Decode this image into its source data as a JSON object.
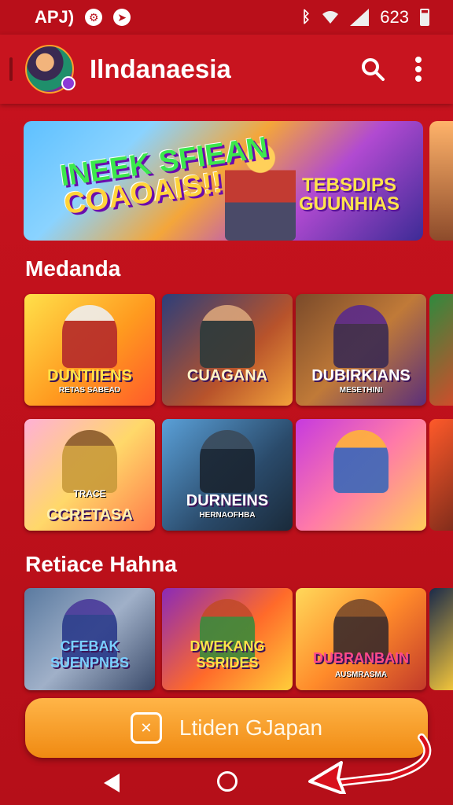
{
  "status_bar": {
    "left_text": "APJ)",
    "icons": [
      "app-icon",
      "location-icon"
    ],
    "battery_text": "623",
    "right_icons": [
      "bluetooth-icon",
      "wifi-icon",
      "signal-icon",
      "battery-icon"
    ]
  },
  "app_bar": {
    "title": "Ilndanaesia",
    "actions": [
      "search-icon",
      "more-vert-icon"
    ]
  },
  "banner": {
    "left_line1": "INEEK SFIEAN",
    "left_line2": "COAOAIS!!",
    "right_line1": "TEBSDIPS",
    "right_line2": "GUUNHIAS"
  },
  "sections": [
    {
      "title": "Medanda",
      "rows": [
        [
          {
            "label": "DUNTIIENS",
            "sub": "RETAS SABEAD"
          },
          {
            "label": "CUAGANA",
            "sub": ""
          },
          {
            "label": "DUBIRKIANS",
            "sub": "MESETHINI"
          }
        ],
        [
          {
            "label": "CCRETASA",
            "sub": "TRACE"
          },
          {
            "label": "DURNEINS",
            "sub": "HERNAOFHBA"
          },
          {
            "label": "",
            "sub": ""
          }
        ]
      ]
    },
    {
      "title": "Retiace Hahna",
      "rows": [
        [
          {
            "label": "CFEBAK SUENPNBS",
            "sub": ""
          },
          {
            "label": "DWEKANG SSRIDES",
            "sub": ""
          },
          {
            "label": "DUBRANBAIN",
            "sub": "AUSMRASMA"
          }
        ]
      ]
    }
  ],
  "cta": {
    "label": "Ltiden GJapan",
    "icon": "launch-icon"
  },
  "nav": [
    "back-icon",
    "home-icon"
  ],
  "colors": {
    "background": "#c8131f",
    "cta": "#f59a1e",
    "title_text": "#ffffff"
  }
}
